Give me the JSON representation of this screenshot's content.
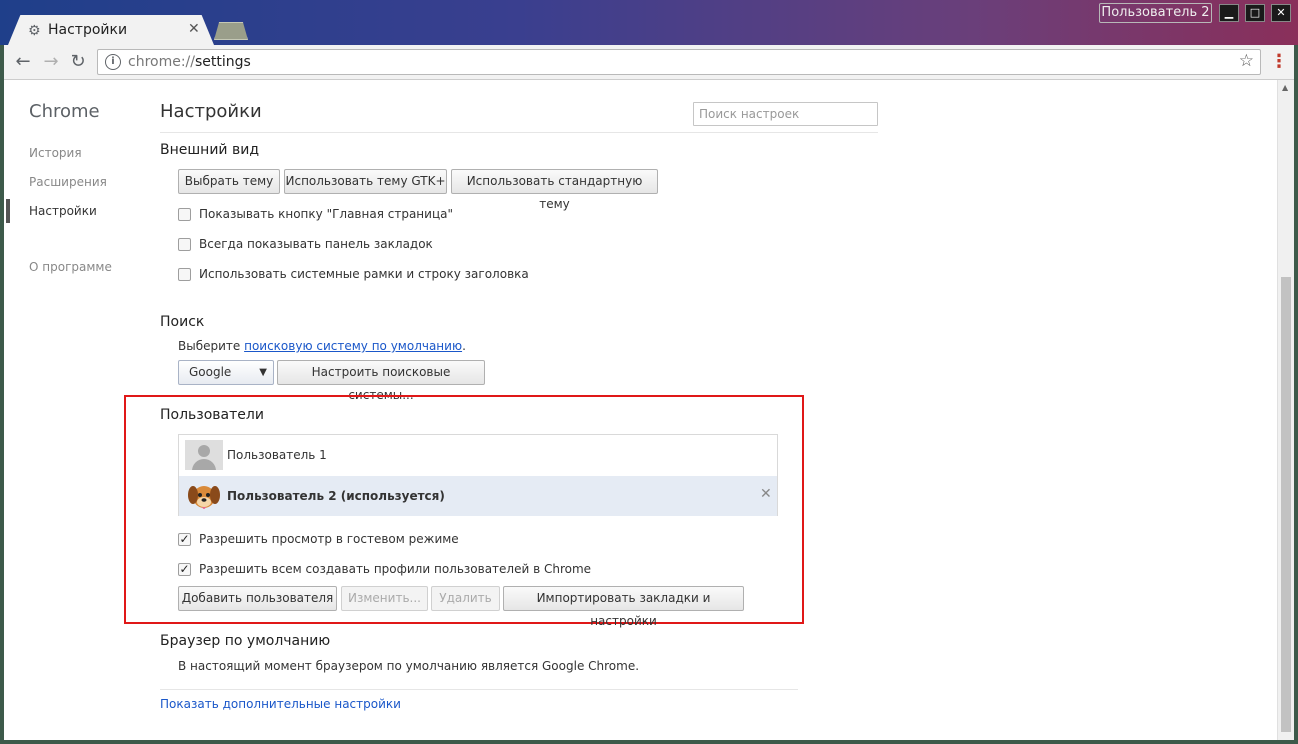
{
  "window": {
    "tab_title": "Настройки",
    "tab_icon": "gear-icon",
    "profile_button": "Пользователь 2",
    "controls": [
      "minimize",
      "maximize",
      "close"
    ]
  },
  "toolbar": {
    "url_scheme": "chrome://",
    "url_path": "settings"
  },
  "sidebar": {
    "brand": "Chrome",
    "items": [
      {
        "label": "История"
      },
      {
        "label": "Расширения"
      },
      {
        "label": "Настройки",
        "active": true
      },
      {
        "label": "О программе"
      }
    ]
  },
  "header": {
    "title": "Настройки",
    "search_placeholder": "Поиск настроек"
  },
  "appearance": {
    "title": "Внешний вид",
    "buttons": [
      "Выбрать тему",
      "Использовать тему GTK+",
      "Использовать стандартную тему"
    ],
    "checkboxes": [
      {
        "label": "Показывать кнопку \"Главная страница\"",
        "checked": false
      },
      {
        "label": "Всегда показывать панель закладок",
        "checked": false
      },
      {
        "label": "Использовать системные рамки и строку заголовка",
        "checked": false
      }
    ]
  },
  "search": {
    "title": "Поиск",
    "prompt_before": "Выберите ",
    "prompt_link": "поисковую систему по умолчанию",
    "prompt_after": ".",
    "engine_selected": "Google",
    "manage_button": "Настроить поисковые системы..."
  },
  "users": {
    "title": "Пользователи",
    "list": [
      {
        "name": "Пользователь 1",
        "avatar": "default-avatar-icon",
        "current": false
      },
      {
        "name": "Пользователь 2 (используется)",
        "avatar": "dog-avatar-icon",
        "current": true
      }
    ],
    "checkboxes": [
      {
        "label": "Разрешить просмотр в гостевом режиме",
        "checked": true
      },
      {
        "label": "Разрешить всем создавать профили пользователей в Chrome",
        "checked": true
      }
    ],
    "buttons": {
      "add": "Добавить пользователя",
      "edit": "Изменить...",
      "delete": "Удалить",
      "import": "Импортировать закладки и настройки"
    },
    "highlight_color": "#e01818"
  },
  "default_browser": {
    "title": "Браузер по умолчанию",
    "status": "В настоящий момент браузером по умолчанию является Google Chrome."
  },
  "advanced_link": "Показать дополнительные настройки"
}
